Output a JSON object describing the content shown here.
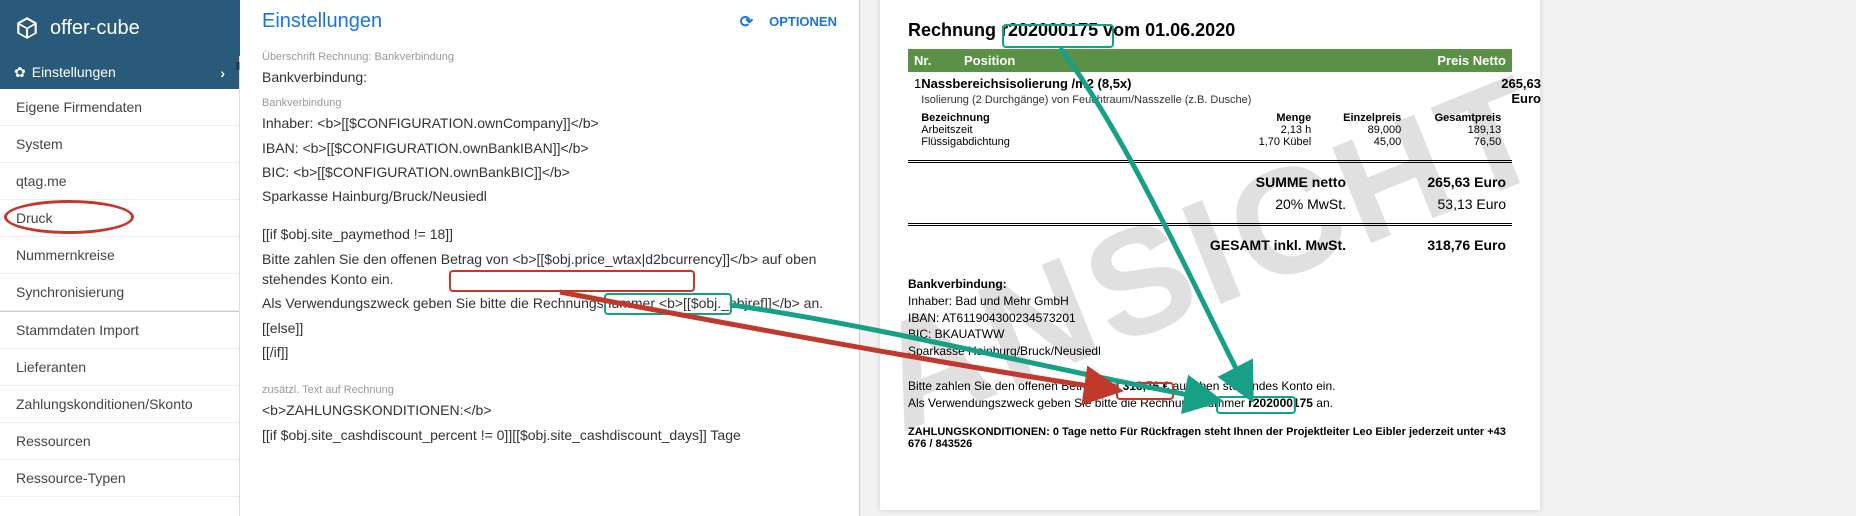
{
  "app": {
    "name": "offer-cube"
  },
  "sidebar": {
    "section": "Einstellungen",
    "items": [
      "Eigene Firmendaten",
      "System",
      "qtag.me",
      "Druck",
      "Nummernkreise",
      "Synchronisierung",
      "Stammdaten Import",
      "Lieferanten",
      "Zahlungskonditionen/Skonto",
      "Ressourcen",
      "Ressource-Typen"
    ]
  },
  "config": {
    "title": "Einstellungen",
    "options_label": "OPTIONEN",
    "lbl_head_bank": "Überschrift Rechnung: Bankverbindung",
    "val_head_bank": "Bankverbindung:",
    "lbl_bank": "Bankverbindung",
    "line_owner": "Inhaber: <b>[[$CONFIGURATION.ownCompany]]</b>",
    "line_iban": "IBAN: <b>[[$CONFIGURATION.ownBankIBAN]]</b>",
    "line_bic": "BIC: <b>[[$CONFIGURATION.ownBankBIC]]</b>",
    "line_bankname": "Sparkasse Hainburg/Bruck/Neusiedl",
    "line_if": "[[if $obj.site_paymethod != 18]]",
    "line_pay_pre": "Bitte zahlen Sie den offenen Betrag von ",
    "line_pay_tok": "<b>[[$obj.price_wtax|d2bcurrency]]</b>",
    "line_pay_post": " auf oben stehendes Konto ein.",
    "line_ref_pre": "Als Verwendungszweck geben Sie bitte die Rechnungsnummer ",
    "line_ref_tok": "<b>[[$obj._objref]]</b>",
    "line_ref_post": " an.",
    "line_else": "[[else]]",
    "line_endif": "[[/if]]",
    "lbl_extra": "zusätzl. Text auf Rechnung",
    "line_cond": "<b>ZAHLUNGSKONDITIONEN:</b>",
    "line_cond2": "[[if $obj.site_cashdiscount_percent != 0]][[$obj.site_cashdiscount_days]] Tage"
  },
  "invoice": {
    "title_pre": "Rechnung ",
    "number": "r202000175",
    "title_post": " vom 01.06.2020",
    "watermark": "ANSICHT",
    "th_nr": "Nr.",
    "th_pos": "Position",
    "th_price": "Preis Netto",
    "row_nr": "1",
    "row_pos": "Nassbereichsisolierung /m2 (8,5x)",
    "row_price": "265,63 Euro",
    "row_sub": "Isolierung (2 Durchgänge) von Feuchtraum/Nasszelle (z.B. Dusche)",
    "dh1": "Bezeichnung",
    "dh2": "Menge",
    "dh3": "Einzelpreis",
    "dh4": "Gesamtpreis",
    "d1a": "Arbeitszeit",
    "d1b": "2,13 h",
    "d1c": "89,000",
    "d1d": "189,13",
    "d2a": "Flüssigabdichtung",
    "d2b": "1,70 Kübel",
    "d2c": "45,00",
    "d2d": "76,50",
    "sum1l": "SUMME netto",
    "sum1v": "265,63 Euro",
    "sum2l": "20% MwSt.",
    "sum2v": "53,13 Euro",
    "sum3l": "GESAMT inkl. MwSt.",
    "sum3v": "318,76 Euro",
    "bank_h": "Bankverbindung:",
    "bank_owner": "Inhaber: Bad und Mehr GmbH",
    "bank_iban": "IBAN: AT611904300234573201",
    "bank_bic": "BIC: BKAUATWW",
    "bank_name": "Sparkasse Hainburg/Bruck/Neusiedl",
    "pay_pre": "Bitte zahlen Sie den offenen Betrag von ",
    "pay_amount": "318,76 €",
    "pay_post": " auf oben stehendes Konto ein.",
    "ref_pre": "Als Verwendungszweck geben Sie bitte die Rechnungsnummer ",
    "ref_num": "r202000175",
    "ref_post": " an.",
    "cond_line": "ZAHLUNGSKONDITIONEN: 0 Tage netto Für Rückfragen steht Ihnen der Projektleiter Leo Eibler jederzeit unter +43 676 / 843526"
  }
}
